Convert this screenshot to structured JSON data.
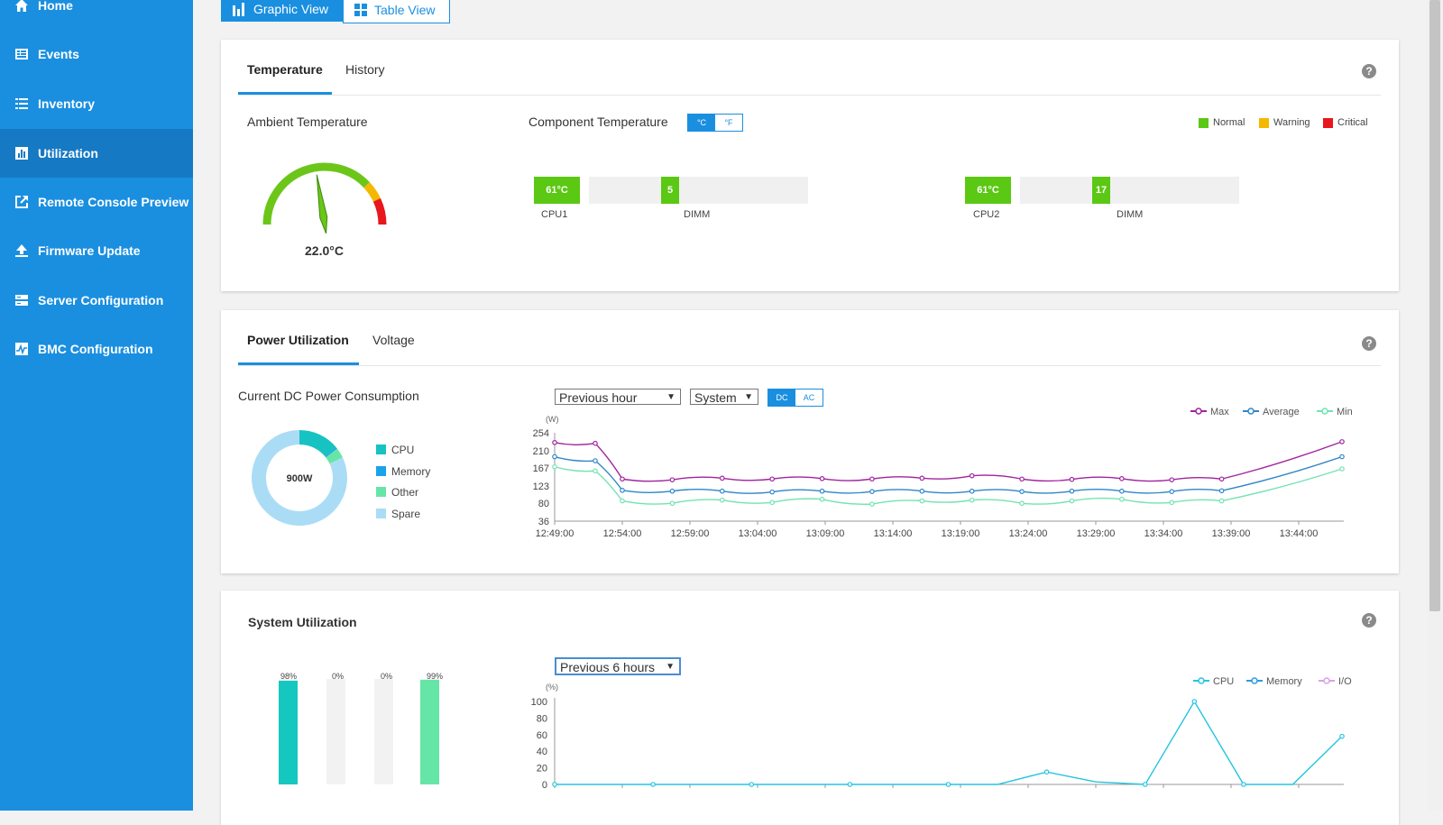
{
  "sidebar": {
    "items": [
      {
        "label": "Home",
        "icon": "home-icon"
      },
      {
        "label": "Events",
        "icon": "events-icon"
      },
      {
        "label": "Inventory",
        "icon": "inventory-icon"
      },
      {
        "label": "Utilization",
        "icon": "utilization-icon",
        "active": true
      },
      {
        "label": "Remote Console Preview",
        "icon": "remote-console-icon"
      },
      {
        "label": "Firmware Update",
        "icon": "firmware-upload-icon"
      },
      {
        "label": "Server Configuration",
        "icon": "server-config-icon"
      },
      {
        "label": "BMC Configuration",
        "icon": "bmc-config-icon"
      }
    ]
  },
  "view_tabs": {
    "graphic": "Graphic View",
    "table": "Table View"
  },
  "temperature": {
    "tabs": [
      "Temperature",
      "History"
    ],
    "ambient_label": "Ambient Temperature",
    "ambient_value": "22.0°C",
    "ambient_gauge_fraction": 0.45,
    "component_label": "Component Temperature",
    "unit_c": "°C",
    "unit_f": "°F",
    "legend": [
      {
        "label": "Normal",
        "color": "#5bc813"
      },
      {
        "label": "Warning",
        "color": "#f5b800"
      },
      {
        "label": "Critical",
        "color": "#e8161d"
      }
    ],
    "components": [
      {
        "cpu_value": "61°C",
        "cpu_label": "CPU1",
        "dimm_value": "5",
        "dimm_label": "DIMM"
      },
      {
        "cpu_value": "61°C",
        "cpu_label": "CPU2",
        "dimm_value": "17",
        "dimm_label": "DIMM"
      }
    ]
  },
  "power": {
    "tabs": [
      "Power Utilization",
      "Voltage"
    ],
    "current_label": "Current DC Power Consumption",
    "donut_center": "900W",
    "donut_legend": [
      {
        "label": "CPU",
        "color": "#17c2c2",
        "fraction": 0.14
      },
      {
        "label": "Memory",
        "color": "#1aa3e8",
        "fraction": 0.005
      },
      {
        "label": "Other",
        "color": "#66e6a6",
        "fraction": 0.035
      },
      {
        "label": "Spare",
        "color": "#aadcf6",
        "fraction": 0.82
      }
    ],
    "period_select": "Previous hour",
    "scope_select": "System",
    "dc": "DC",
    "ac": "AC"
  },
  "system_util": {
    "title": "System Utilization",
    "period_select": "Previous 6 hours",
    "bars": [
      {
        "pct": "98%",
        "value": 98,
        "color": "#14c8c0"
      },
      {
        "pct": "0%",
        "value": 0,
        "color": "#14c8c0"
      },
      {
        "pct": "0%",
        "value": 0,
        "color": "#14c8c0"
      },
      {
        "pct": "99%",
        "value": 99,
        "color": "#66e6a6"
      }
    ]
  },
  "chart_data": [
    {
      "type": "line",
      "ylabel": "(W)",
      "yticks": [
        254,
        210,
        167,
        123,
        80,
        36
      ],
      "ylim": [
        36,
        254
      ],
      "x_ticks": [
        "12:49:00",
        "12:54:00",
        "12:59:00",
        "13:04:00",
        "13:09:00",
        "13:14:00",
        "13:19:00",
        "13:24:00",
        "13:29:00",
        "13:34:00",
        "13:39:00",
        "13:44:00"
      ],
      "legend": "top-right",
      "grid": false,
      "series": [
        {
          "name": "Max",
          "color": "#a0249e",
          "values": [
            230,
            228,
            140,
            138,
            142,
            140,
            141,
            140,
            142,
            148,
            140,
            139,
            141,
            138,
            140,
            232
          ]
        },
        {
          "name": "Average",
          "color": "#2f86c8",
          "values": [
            195,
            185,
            112,
            110,
            110,
            108,
            110,
            109,
            110,
            110,
            109,
            110,
            110,
            109,
            111,
            195
          ]
        },
        {
          "name": "Min",
          "color": "#72e3b2",
          "values": [
            170,
            160,
            86,
            80,
            88,
            82,
            90,
            78,
            86,
            88,
            80,
            86,
            90,
            82,
            86,
            165
          ]
        }
      ]
    },
    {
      "type": "line",
      "ylabel": "(%)",
      "yticks": [
        100,
        80,
        60,
        40,
        20,
        0
      ],
      "ylim": [
        0,
        100
      ],
      "legend": "top-right",
      "grid": false,
      "series": [
        {
          "name": "CPU",
          "color": "#24c5e0",
          "values": [
            0,
            0,
            0,
            0,
            0,
            0,
            0,
            0,
            0,
            0,
            15,
            3,
            0,
            100,
            0,
            0,
            58
          ]
        },
        {
          "name": "Memory",
          "color": "#2f9be0",
          "values": []
        },
        {
          "name": "I/O",
          "color": "#d9a2e6",
          "values": []
        }
      ]
    }
  ]
}
